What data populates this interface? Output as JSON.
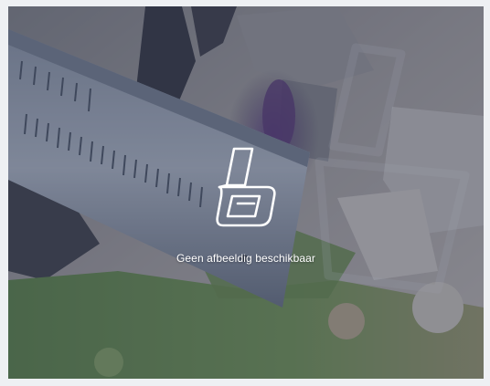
{
  "placeholder": {
    "message": "Geen afbeeldig beschikbaar",
    "icon": "brand-logo-icon"
  },
  "colors": {
    "overlay": "#343e5c",
    "icon_stroke": "#ffffff",
    "page_background": "#eef0f3"
  }
}
